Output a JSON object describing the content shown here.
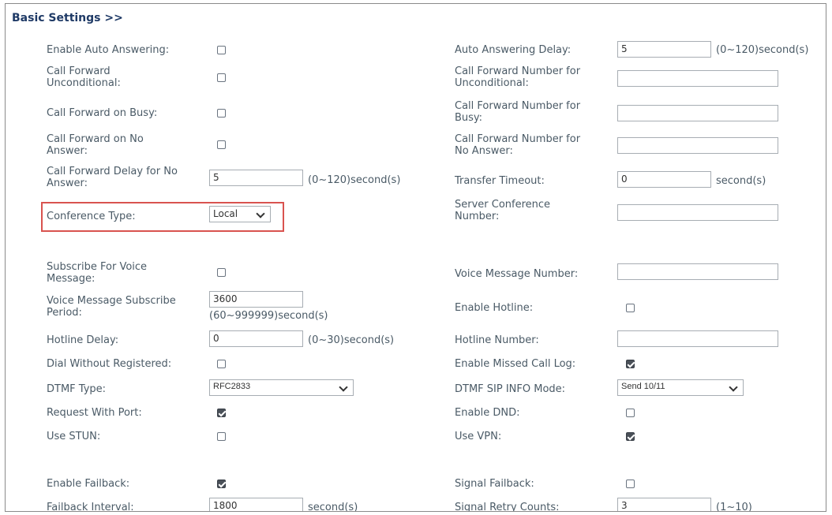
{
  "section_title": "Basic Settings >>",
  "left": {
    "auto_answer": "Enable Auto Answering:",
    "cfu": [
      "Call Forward",
      "Unconditional:"
    ],
    "cfb": "Call Forward on Busy:",
    "cfna": [
      "Call Forward on No",
      "Answer:"
    ],
    "cf_delay": [
      "Call Forward Delay for No",
      "Answer:"
    ],
    "cf_delay_value": "5",
    "cf_delay_suffix": "(0~120)second(s)",
    "conf_type": "Conference Type:",
    "conf_type_value": "Local",
    "svm": [
      "Subscribe For Voice",
      "Message:"
    ],
    "vm_period": [
      "Voice Message Subscribe",
      "Period:"
    ],
    "vm_period_value": "3600",
    "vm_period_suffix": "(60~999999)second(s)",
    "hotline_delay": "Hotline Delay:",
    "hotline_delay_value": "0",
    "hotline_delay_suffix": "(0~30)second(s)",
    "dial_wo_reg": "Dial Without Registered:",
    "dtmf_type": "DTMF Type:",
    "dtmf_type_value": "RFC2833",
    "req_port": "Request With Port:",
    "stun": "Use STUN:",
    "failback": "Enable Failback:",
    "failback_interval": "Failback Interval:",
    "failback_interval_value": "1800",
    "failback_interval_suffix": "second(s)"
  },
  "right": {
    "aa_delay": "Auto Answering Delay:",
    "aa_delay_value": "5",
    "aa_delay_suffix": "(0~120)second(s)",
    "cfu_num": [
      "Call Forward Number for",
      "Unconditional:"
    ],
    "cfb_num": [
      "Call Forward Number for",
      "Busy:"
    ],
    "cfna_num": [
      "Call Forward Number for",
      "No Answer:"
    ],
    "transfer_timeout": "Transfer Timeout:",
    "transfer_timeout_value": "0",
    "transfer_timeout_suffix": "second(s)",
    "server_conf": [
      "Server Conference",
      "Number:"
    ],
    "vm_number": "Voice Message Number:",
    "hotline": "Enable Hotline:",
    "hotline_number": "Hotline Number:",
    "missed_call": "Enable Missed Call Log:",
    "dtmf_sip": "DTMF SIP INFO Mode:",
    "dtmf_sip_value": "Send 10/11",
    "dnd": "Enable DND:",
    "vpn": "Use VPN:",
    "signal_failback": "Signal Failback:",
    "retry": "Signal Retry Counts:",
    "retry_value": "3",
    "retry_suffix": "(1~10)"
  },
  "checkboxes": {
    "auto_answer": false,
    "cfu": false,
    "cfb": false,
    "cfna": false,
    "svm": false,
    "hotline": false,
    "dial_wo_reg": false,
    "missed_call": true,
    "req_port": true,
    "dnd": false,
    "stun": false,
    "vpn": true,
    "failback": true,
    "signal_failback": false
  }
}
